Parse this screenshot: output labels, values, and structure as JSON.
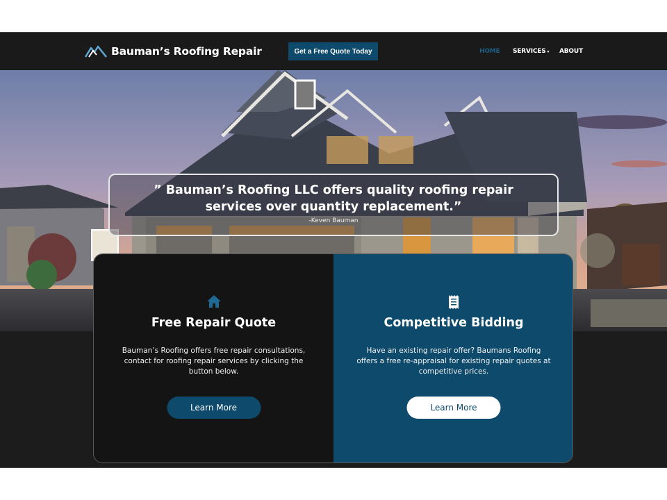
{
  "header": {
    "brand": "Bauman’s Roofing Repair",
    "cta_label": "Get a Free Quote Today",
    "nav": {
      "home": "HOME",
      "services": "SERVICES",
      "about": "ABOUT"
    }
  },
  "hero": {
    "quote_line1": "” Bauman’s Roofing LLC offers quality roofing repair",
    "quote_line2": "services over quantity replacement.”",
    "author": "-Keven Bauman"
  },
  "cards": [
    {
      "title": "Free Repair Quote",
      "icon": "home-icon",
      "body": "Bauman’s Roofing offers free repair consultations, contact for roofing repair services by clicking the button below.",
      "button": "Learn More"
    },
    {
      "title": "Competitive Bidding",
      "icon": "receipt-icon",
      "body": "Have an existing repair offer? Baumans Roofing offers a free re-appraisal for existing repair quotes at competitive prices.",
      "button": "Learn More"
    }
  ],
  "colors": {
    "brand_blue": "#0d4a6b",
    "header_bg": "#1a1a1a",
    "dark_card": "#141414"
  }
}
